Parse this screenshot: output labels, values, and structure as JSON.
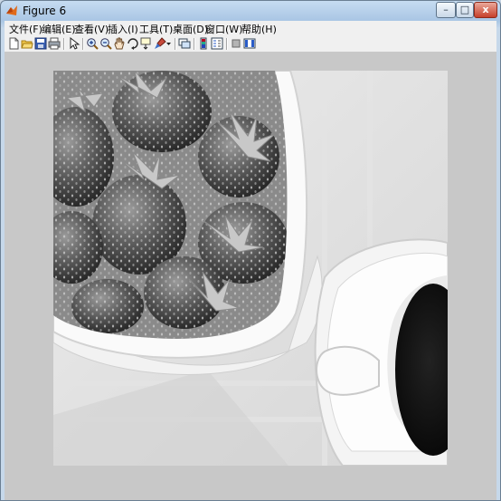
{
  "window": {
    "title": "Figure 6"
  },
  "menu": [
    "文件(F)",
    "编辑(E)",
    "查看(V)",
    "插入(I)",
    "工具(T)",
    "桌面(D)",
    "窗口(W)",
    "帮助(H)"
  ],
  "window_controls": {
    "minimize": "–",
    "maximize": "□",
    "close": "x"
  },
  "toolbar_icons": [
    "new-figure-icon",
    "open-file-icon",
    "save-icon",
    "print-icon",
    "edit-plot-icon",
    "zoom-in-icon",
    "zoom-out-icon",
    "pan-icon",
    "rotate-3d-icon",
    "data-cursor-icon",
    "brush-icon",
    "brush-dropdown-icon",
    "link-plot-icon",
    "insert-colorbar-icon",
    "insert-legend-icon",
    "hide-plot-tools-icon",
    "show-plot-tools-icon"
  ],
  "image": {
    "subject": "grayscale photo: bowl of strawberries and a cup of coffee",
    "colormap": "gray"
  }
}
